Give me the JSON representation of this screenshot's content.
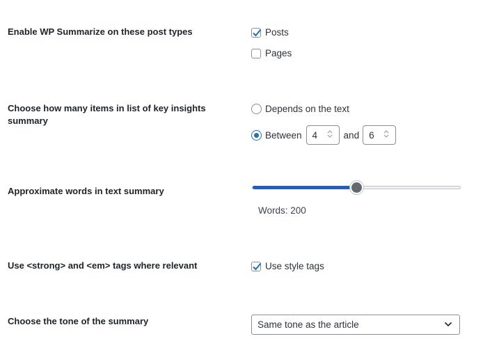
{
  "post_types": {
    "label": "Enable WP Summarize on these post types",
    "options": [
      {
        "label": "Posts",
        "checked": true
      },
      {
        "label": "Pages",
        "checked": false
      }
    ]
  },
  "key_insights": {
    "label": "Choose how many items in list of key insights summary",
    "option_depends": "Depends on the text",
    "option_between": "Between",
    "selected": "between",
    "min_value": "4",
    "and_label": "and",
    "max_value": "6"
  },
  "text_summary": {
    "label": "Approximate words in text summary",
    "words_text": "Words: 200",
    "slider_fraction": 0.5
  },
  "style_tags": {
    "label": "Use <strong> and <em> tags where relevant",
    "checkbox_label": "Use style tags",
    "checked": true
  },
  "tone": {
    "label": "Choose the tone of the summary",
    "selected": "Same tone as the article"
  },
  "colors": {
    "accent": "#2271b1",
    "slider_fill": "#1a5ed6",
    "thumb": "#646970"
  }
}
